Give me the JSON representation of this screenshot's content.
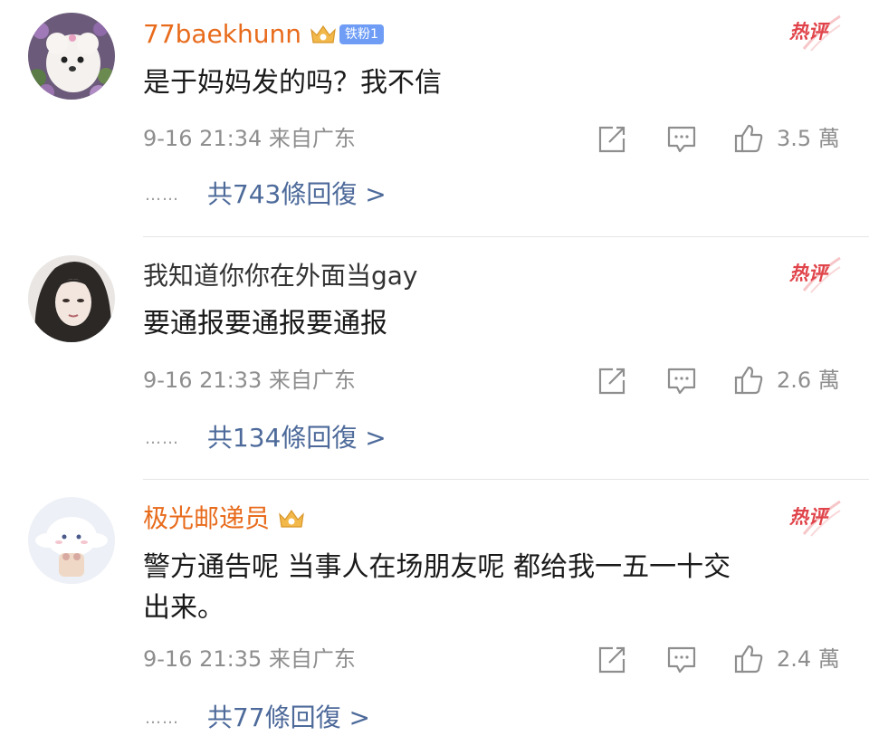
{
  "colors": {
    "vip_name": "#e86b1c",
    "plain_name": "#333333",
    "meta": "#8e8e8e",
    "reply_link": "#4d6a9a",
    "hot_tag": "#e0444a",
    "fan_badge": "#6f9df6"
  },
  "comments": [
    {
      "username": "77baekhunn",
      "badge": "铁粉1",
      "hot_label": "热评",
      "content": "是于妈妈发的吗？我不信",
      "timestamp": "9-16 21:34",
      "location": "来自广东",
      "likes": "3.5 萬",
      "replies_prefix": "共",
      "replies_count": "743",
      "replies_suffix": "條回復 >",
      "dots": "……",
      "icons": [
        "share-icon",
        "comment-icon",
        "like-icon"
      ]
    },
    {
      "username": "我知道你你在外面当gay",
      "hot_label": "热评",
      "content": "要通报要通报要通报",
      "timestamp": "9-16 21:33",
      "location": "来自广东",
      "likes": "2.6 萬",
      "replies_prefix": "共",
      "replies_count": "134",
      "replies_suffix": "條回復 >",
      "dots": "……",
      "icons": [
        "share-icon",
        "comment-icon",
        "like-icon"
      ]
    },
    {
      "username": "极光邮递员",
      "hot_label": "热评",
      "content": "警方通告呢 当事人在场朋友呢 都给我一五一十交\n出来。",
      "timestamp": "9-16 21:35",
      "location": "来自广东",
      "likes": "2.4 萬",
      "replies_prefix": "共",
      "replies_count": "77",
      "replies_suffix": "條回復 >",
      "dots": "……",
      "icons": [
        "share-icon",
        "comment-icon",
        "like-icon"
      ]
    }
  ]
}
